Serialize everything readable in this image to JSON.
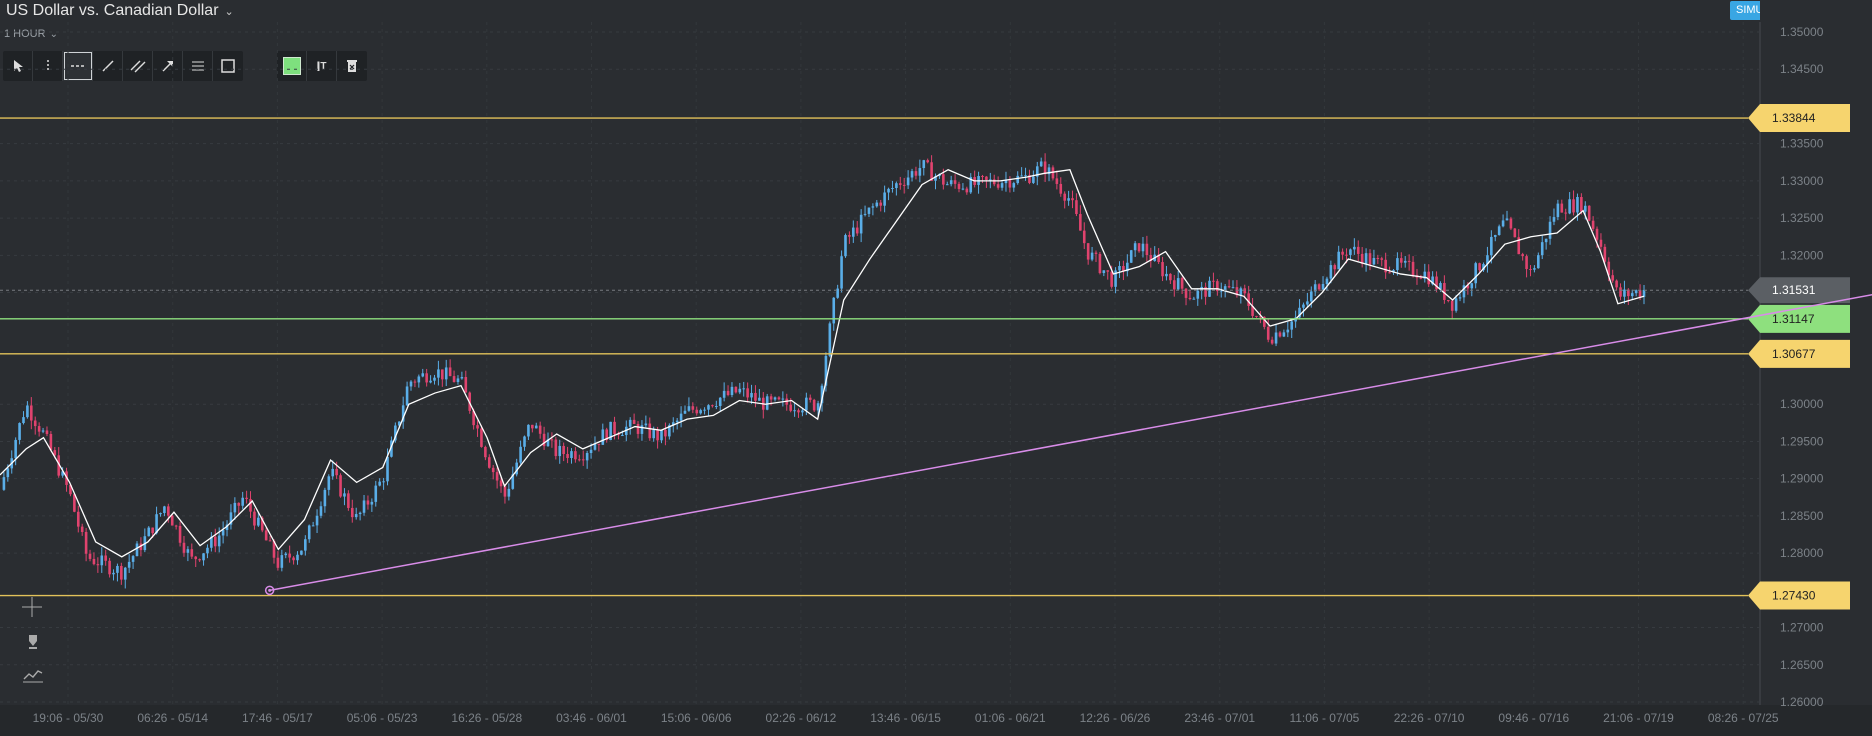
{
  "header": {
    "title": "US Dollar vs. Canadian Dollar",
    "timeframe": "1 HOUR",
    "mode_badge": "SIMULATOR"
  },
  "icons": {
    "title_dropdown": "chevron-down-icon",
    "timeframe_dropdown": "chevron-down-icon",
    "link": "link-icon",
    "close": "close-icon"
  },
  "toolbar": {
    "tools": [
      {
        "name": "pointer",
        "icon": "pointer-icon"
      },
      {
        "name": "vertical-line",
        "icon": "vertical-line-icon"
      },
      {
        "name": "horizontal-line",
        "icon": "horizontal-line-icon",
        "active": true
      },
      {
        "name": "trend-line",
        "icon": "trend-line-icon"
      },
      {
        "name": "parallel-channel",
        "icon": "parallel-channel-icon"
      },
      {
        "name": "arrow",
        "icon": "arrow-icon"
      },
      {
        "name": "fibonacci",
        "icon": "lines-icon"
      },
      {
        "name": "rectangle",
        "icon": "rectangle-icon"
      }
    ],
    "color_swatch": "#7ee07e",
    "text_tool_icon": "text-icon",
    "delete_icon": "trash-icon"
  },
  "side_tools": [
    "crosshair-icon",
    "pen-icon",
    "indicator-icon"
  ],
  "colors": {
    "background": "#2a2d31",
    "up_candle": "#5aaee8",
    "down_candle": "#e0436e",
    "moving_average": "#ffffff",
    "trendline": "#d88ce8",
    "level_line": "#e2c25a",
    "level_label": "#f6d46e",
    "green_level": "#8ee07e",
    "current_price": "#5b5f64"
  },
  "chart_data": {
    "type": "candlestick",
    "instrument": "US Dollar vs. Canadian Dollar",
    "interval": "1 HOUR",
    "ylim": [
      1.26,
      1.35
    ],
    "y_ticks": [
      "1.35000",
      "1.34500",
      "1.33500",
      "1.33000",
      "1.32500",
      "1.32000",
      "1.31500",
      "1.30000",
      "1.29500",
      "1.29000",
      "1.28500",
      "1.28000",
      "1.27000",
      "1.26500",
      "1.26000"
    ],
    "x_ticks": [
      "19:06 - 05/30",
      "06:26 - 05/14",
      "17:46 - 05/17",
      "05:06 - 05/23",
      "16:26 - 05/28",
      "03:46 - 06/01",
      "15:06 - 06/06",
      "02:26 - 06/12",
      "13:46 - 06/15",
      "01:06 - 06/21",
      "12:26 - 06/26",
      "23:46 - 07/01",
      "11:06 - 07/05",
      "22:26 - 07/10",
      "09:46 - 07/16",
      "21:06 - 07/19",
      "08:26 - 07/25"
    ],
    "grid": true,
    "price_path": [
      [
        0,
        1.2885
      ],
      [
        3,
        1.3
      ],
      [
        5,
        1.296
      ],
      [
        8,
        1.288
      ],
      [
        10,
        1.2795
      ],
      [
        14,
        1.2775
      ],
      [
        17,
        1.2825
      ],
      [
        19,
        1.2865
      ],
      [
        22,
        1.279
      ],
      [
        25,
        1.282
      ],
      [
        28,
        1.2875
      ],
      [
        32,
        1.2785
      ],
      [
        35,
        1.281
      ],
      [
        38,
        1.291
      ],
      [
        41,
        1.2845
      ],
      [
        44,
        1.29
      ],
      [
        47,
        1.303
      ],
      [
        50,
        1.3045
      ],
      [
        53,
        1.303
      ],
      [
        56,
        1.293
      ],
      [
        58,
        1.2875
      ],
      [
        61,
        1.2975
      ],
      [
        64,
        1.2935
      ],
      [
        67,
        1.2935
      ],
      [
        70,
        1.2965
      ],
      [
        73,
        1.297
      ],
      [
        76,
        1.2955
      ],
      [
        79,
        1.299
      ],
      [
        82,
        1.3005
      ],
      [
        85,
        1.3018
      ],
      [
        88,
        1.3
      ],
      [
        91,
        1.3
      ],
      [
        94,
        1.3
      ],
      [
        97,
        1.3215
      ],
      [
        100,
        1.326
      ],
      [
        103,
        1.3295
      ],
      [
        106,
        1.332
      ],
      [
        109,
        1.3295
      ],
      [
        112,
        1.3295
      ],
      [
        115,
        1.33
      ],
      [
        118,
        1.3305
      ],
      [
        120,
        1.332
      ],
      [
        123,
        1.3275
      ],
      [
        125,
        1.3205
      ],
      [
        128,
        1.3165
      ],
      [
        131,
        1.3215
      ],
      [
        134,
        1.3175
      ],
      [
        137,
        1.3145
      ],
      [
        140,
        1.316
      ],
      [
        143,
        1.3145
      ],
      [
        146,
        1.309
      ],
      [
        149,
        1.3115
      ],
      [
        152,
        1.317
      ],
      [
        155,
        1.321
      ],
      [
        158,
        1.319
      ],
      [
        161,
        1.3185
      ],
      [
        164,
        1.3175
      ],
      [
        167,
        1.3135
      ],
      [
        170,
        1.3185
      ],
      [
        173,
        1.3245
      ],
      [
        176,
        1.3175
      ],
      [
        179,
        1.3265
      ],
      [
        182,
        1.327
      ],
      [
        184,
        1.3215
      ],
      [
        186,
        1.3145
      ],
      [
        189,
        1.3153
      ]
    ],
    "moving_average_path": [
      [
        0,
        1.2905
      ],
      [
        3,
        1.294
      ],
      [
        5,
        1.2955
      ],
      [
        8,
        1.2895
      ],
      [
        11,
        1.2815
      ],
      [
        14,
        1.2795
      ],
      [
        17,
        1.2815
      ],
      [
        20,
        1.2855
      ],
      [
        23,
        1.281
      ],
      [
        26,
        1.2835
      ],
      [
        29,
        1.287
      ],
      [
        32,
        1.2805
      ],
      [
        35,
        1.2845
      ],
      [
        38,
        1.2925
      ],
      [
        41,
        1.2895
      ],
      [
        44,
        1.2915
      ],
      [
        47,
        1.3
      ],
      [
        50,
        1.3015
      ],
      [
        53,
        1.3025
      ],
      [
        56,
        1.2955
      ],
      [
        58,
        1.289
      ],
      [
        61,
        1.2935
      ],
      [
        64,
        1.296
      ],
      [
        67,
        1.294
      ],
      [
        70,
        1.2955
      ],
      [
        73,
        1.297
      ],
      [
        76,
        1.2965
      ],
      [
        79,
        1.298
      ],
      [
        82,
        1.2985
      ],
      [
        85,
        1.3005
      ],
      [
        88,
        1.3
      ],
      [
        91,
        1.3005
      ],
      [
        94,
        1.298
      ],
      [
        97,
        1.314
      ],
      [
        100,
        1.3195
      ],
      [
        103,
        1.3245
      ],
      [
        106,
        1.3295
      ],
      [
        109,
        1.3315
      ],
      [
        112,
        1.33
      ],
      [
        115,
        1.33
      ],
      [
        118,
        1.3305
      ],
      [
        120,
        1.331
      ],
      [
        123,
        1.3315
      ],
      [
        125,
        1.3255
      ],
      [
        128,
        1.3175
      ],
      [
        131,
        1.3185
      ],
      [
        134,
        1.3205
      ],
      [
        137,
        1.3155
      ],
      [
        140,
        1.3155
      ],
      [
        143,
        1.3145
      ],
      [
        146,
        1.3105
      ],
      [
        149,
        1.3115
      ],
      [
        152,
        1.315
      ],
      [
        155,
        1.3195
      ],
      [
        158,
        1.3185
      ],
      [
        161,
        1.3175
      ],
      [
        164,
        1.317
      ],
      [
        167,
        1.314
      ],
      [
        170,
        1.3175
      ],
      [
        173,
        1.3215
      ],
      [
        176,
        1.3225
      ],
      [
        179,
        1.323
      ],
      [
        182,
        1.326
      ],
      [
        184,
        1.3205
      ],
      [
        186,
        1.3135
      ],
      [
        189,
        1.3145
      ]
    ],
    "horizontal_levels": [
      {
        "value": 1.33844,
        "label": "1.33844",
        "kind": "level"
      },
      {
        "value": 1.31147,
        "label": "1.31147",
        "kind": "green"
      },
      {
        "value": 1.30677,
        "label": "1.30677",
        "kind": "level"
      },
      {
        "value": 1.2743,
        "label": "1.27430",
        "kind": "level"
      }
    ],
    "current_price": {
      "value": 1.31531,
      "label": "1.31531"
    },
    "trendline": {
      "start": [
        31,
        1.275
      ],
      "end": [
        218,
        1.3153
      ]
    }
  }
}
